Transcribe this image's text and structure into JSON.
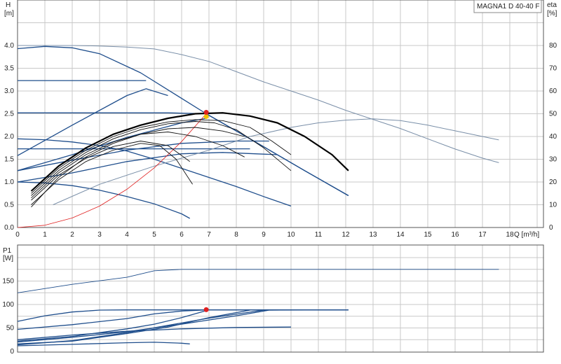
{
  "chart_data": [
    {
      "type": "line",
      "title": "MAGNA1 D 40-40 F",
      "xlabel": "Q [m³/h]",
      "ylabel": "H [m]",
      "ylabel_lines": [
        "H",
        "[m]"
      ],
      "y2label_lines": [
        "eta",
        "[%]"
      ],
      "x_tick_suffix": "Q [m³/h]",
      "xlim": [
        0,
        19
      ],
      "ylim": [
        0,
        5
      ],
      "y2lim": [
        0,
        100
      ],
      "x_ticks": [
        "0",
        "1",
        "2",
        "3",
        "4",
        "5",
        "6",
        "7",
        "8",
        "9",
        "10",
        "11",
        "12",
        "13",
        "14",
        "15",
        "16",
        "17",
        "18"
      ],
      "y_ticks": [
        "0.0",
        "0.5",
        "1.0",
        "1.5",
        "2.0",
        "2.5",
        "3.0",
        "3.5",
        "4.0"
      ],
      "y2_ticks": [
        "0",
        "10",
        "20",
        "30",
        "40",
        "50",
        "60",
        "70",
        "80"
      ],
      "grid": true,
      "colors": {
        "head": "#1f4e8c",
        "efficiency": "#7a8fa8",
        "system": "#e02020",
        "duty_point": "#e02020",
        "duty_highlight": "#f2c200",
        "bold": "#000000",
        "thin": "#111111"
      },
      "duty_point": {
        "x": 6.9,
        "y": 2.5
      },
      "series": [
        {
          "kind": "head",
          "x": [
            0,
            1,
            2,
            3,
            4.5,
            6.9,
            8.5,
            10.5,
            12.1
          ],
          "y": [
            3.93,
            3.98,
            3.95,
            3.82,
            3.4,
            2.5,
            1.95,
            1.25,
            0.7
          ]
        },
        {
          "kind": "head",
          "x": [
            0,
            2,
            4,
            5.5,
            6.9,
            8.5,
            10.5,
            12.1
          ],
          "y": [
            2.52,
            2.52,
            2.52,
            2.52,
            2.5,
            1.95,
            1.25,
            0.7
          ]
        },
        {
          "kind": "head",
          "x": [
            0,
            1,
            2,
            3,
            4,
            4.7
          ],
          "y": [
            3.23,
            3.23,
            3.23,
            3.23,
            3.23,
            3.23
          ]
        },
        {
          "kind": "head",
          "x": [
            0,
            2,
            4,
            4.7,
            5.5
          ],
          "y": [
            1.58,
            2.25,
            2.9,
            3.05,
            2.9
          ]
        },
        {
          "kind": "head",
          "x": [
            0,
            1,
            2,
            3,
            4,
            5,
            6,
            7,
            8,
            9,
            10
          ],
          "y": [
            1.95,
            1.93,
            1.88,
            1.8,
            1.68,
            1.5,
            1.3,
            1.1,
            0.9,
            0.68,
            0.47
          ]
        },
        {
          "kind": "head",
          "x": [
            0,
            2,
            4,
            6,
            8,
            8.5
          ],
          "y": [
            1.73,
            1.73,
            1.73,
            1.73,
            1.73,
            1.73
          ]
        },
        {
          "kind": "head",
          "x": [
            0,
            1,
            2,
            3,
            4,
            5,
            6,
            6.3
          ],
          "y": [
            1.0,
            0.98,
            0.92,
            0.82,
            0.68,
            0.52,
            0.3,
            0.2
          ]
        },
        {
          "kind": "head",
          "x": [
            0,
            2,
            4,
            6,
            8,
            9.2
          ],
          "y": [
            1.25,
            1.48,
            1.7,
            1.85,
            1.9,
            1.9
          ]
        },
        {
          "kind": "head",
          "x": [
            0,
            2,
            4,
            6,
            6.9
          ],
          "y": [
            1.25,
            1.6,
            1.98,
            2.3,
            2.4
          ]
        },
        {
          "kind": "head",
          "x": [
            0,
            2,
            4,
            6,
            7.5,
            9.5
          ],
          "y": [
            1.0,
            1.2,
            1.45,
            1.62,
            1.65,
            1.6
          ]
        },
        {
          "kind": "efficiency",
          "x": [
            0,
            1,
            2,
            3,
            4,
            5,
            6,
            7,
            8,
            9,
            10,
            11,
            12,
            13,
            14,
            15,
            16,
            17,
            17.6
          ],
          "y": [
            80,
            80,
            80,
            79.8,
            79.3,
            78.5,
            76,
            73,
            68.5,
            64,
            60,
            56,
            51.5,
            47.5,
            43.5,
            39,
            34.5,
            30.5,
            28.5
          ]
        },
        {
          "kind": "efficiency",
          "x": [
            1.3,
            3,
            5,
            7,
            8.5,
            10,
            11,
            12,
            13,
            14,
            15,
            16,
            17,
            17.6
          ],
          "y": [
            10,
            19,
            27,
            34,
            40,
            44,
            46,
            47.2,
            47.8,
            47,
            45,
            42.5,
            40,
            38.5
          ]
        },
        {
          "kind": "system",
          "x": [
            0,
            1,
            2,
            3,
            4,
            5,
            6,
            6.9
          ],
          "y": [
            0,
            0.05,
            0.21,
            0.47,
            0.84,
            1.31,
            1.89,
            2.5
          ]
        },
        {
          "kind": "bold",
          "x": [
            0.5,
            1.5,
            2.5,
            3.5,
            4.5,
            5.5,
            6.5,
            7.5,
            8.5,
            9.5,
            10.5,
            11.5,
            12.1
          ],
          "y": [
            0.8,
            1.35,
            1.75,
            2.05,
            2.25,
            2.4,
            2.5,
            2.52,
            2.45,
            2.3,
            2.0,
            1.6,
            1.25
          ]
        },
        {
          "kind": "thin",
          "x": [
            0.5,
            1.5,
            2.5,
            3.5,
            4.5,
            5.5,
            6.5,
            7.5,
            8.5,
            9.3,
            10
          ],
          "y": [
            0.75,
            1.3,
            1.7,
            2.0,
            2.2,
            2.32,
            2.37,
            2.35,
            2.2,
            1.9,
            1.6
          ]
        },
        {
          "kind": "thin",
          "x": [
            0.5,
            1.5,
            2.5,
            3.5,
            4.5,
            5.5,
            6.5,
            7.2,
            8,
            9,
            10
          ],
          "y": [
            0.7,
            1.25,
            1.65,
            1.95,
            2.15,
            2.28,
            2.33,
            2.3,
            2.15,
            1.75,
            1.25
          ]
        },
        {
          "kind": "thin",
          "x": [
            0.5,
            1.5,
            2.5,
            3.5,
            4.5,
            5.5,
            6.5,
            7.5,
            8.3
          ],
          "y": [
            0.65,
            1.2,
            1.6,
            1.88,
            2.05,
            2.1,
            2.0,
            1.8,
            1.55
          ]
        },
        {
          "kind": "thin",
          "x": [
            0.5,
            1.5,
            2.5,
            3.5,
            4.5,
            5.5,
            6.3
          ],
          "y": [
            0.6,
            1.15,
            1.52,
            1.78,
            1.9,
            1.8,
            1.45
          ]
        },
        {
          "kind": "thin",
          "x": [
            0.5,
            1.5,
            2.5,
            3.5,
            4.5,
            5.2,
            5.8,
            6.4
          ],
          "y": [
            0.5,
            1.05,
            1.45,
            1.7,
            1.85,
            1.8,
            1.5,
            0.95
          ]
        },
        {
          "kind": "thin",
          "x": [
            0.5,
            1.5,
            2.5,
            3.5,
            4.5,
            5.5,
            6.5,
            7.5,
            8.3
          ],
          "y": [
            0.45,
            1.1,
            1.55,
            1.85,
            2.05,
            2.17,
            2.2,
            2.12,
            2.0
          ]
        }
      ]
    },
    {
      "type": "line",
      "title": "",
      "xlabel": "",
      "ylabel": "P1 [W]",
      "ylabel_lines": [
        "P1",
        "[W]"
      ],
      "xlim": [
        0,
        19
      ],
      "ylim": [
        0,
        200
      ],
      "y_ticks": [
        "0",
        "50",
        "100",
        "150"
      ],
      "grid": true,
      "colors": {
        "power": "#1f4e8c",
        "duty_point": "#e02020"
      },
      "duty_point": {
        "x": 6.9,
        "y": 89
      },
      "series": [
        {
          "kind": "thin_top",
          "x": [
            0,
            2,
            4,
            5,
            6,
            8,
            10,
            14,
            17.6
          ],
          "y": [
            125,
            143,
            158,
            172,
            175,
            175,
            175,
            175,
            175
          ]
        },
        {
          "kind": "power",
          "x": [
            0,
            1,
            2,
            3,
            4,
            5,
            6,
            6.9,
            9,
            12.1
          ],
          "y": [
            64,
            76,
            84,
            88,
            88.5,
            88.5,
            88.5,
            88.5,
            88.5,
            88.5
          ]
        },
        {
          "kind": "power",
          "x": [
            0,
            2,
            4,
            5,
            6,
            6.9,
            9,
            12.1
          ],
          "y": [
            47,
            57,
            70,
            80,
            86,
            88.5,
            88.5,
            88.5
          ]
        },
        {
          "kind": "power",
          "x": [
            0,
            2,
            4,
            5,
            6,
            6.9
          ],
          "y": [
            22,
            32,
            48,
            58,
            72,
            87
          ]
        },
        {
          "kind": "power",
          "x": [
            0,
            2,
            4,
            6,
            8,
            9.2,
            10,
            12.1
          ],
          "y": [
            20,
            30,
            42,
            58,
            76,
            88,
            88.5,
            88.5
          ]
        },
        {
          "kind": "power",
          "x": [
            0,
            2,
            4,
            6,
            8,
            10
          ],
          "y": [
            25,
            35,
            43,
            48,
            51,
            52
          ]
        },
        {
          "kind": "power",
          "x": [
            0,
            2,
            4,
            6.9,
            9,
            12.1
          ],
          "y": [
            14,
            23,
            40,
            70,
            88,
            88.5
          ]
        },
        {
          "kind": "power",
          "x": [
            0,
            2,
            4,
            5,
            6,
            6.3
          ],
          "y": [
            12,
            15,
            18.5,
            19.5,
            17.5,
            16
          ]
        },
        {
          "kind": "power",
          "x": [
            0,
            2,
            4,
            5.5,
            7,
            8.5
          ],
          "y": [
            16,
            22,
            38,
            52,
            72,
            88
          ]
        }
      ]
    }
  ]
}
